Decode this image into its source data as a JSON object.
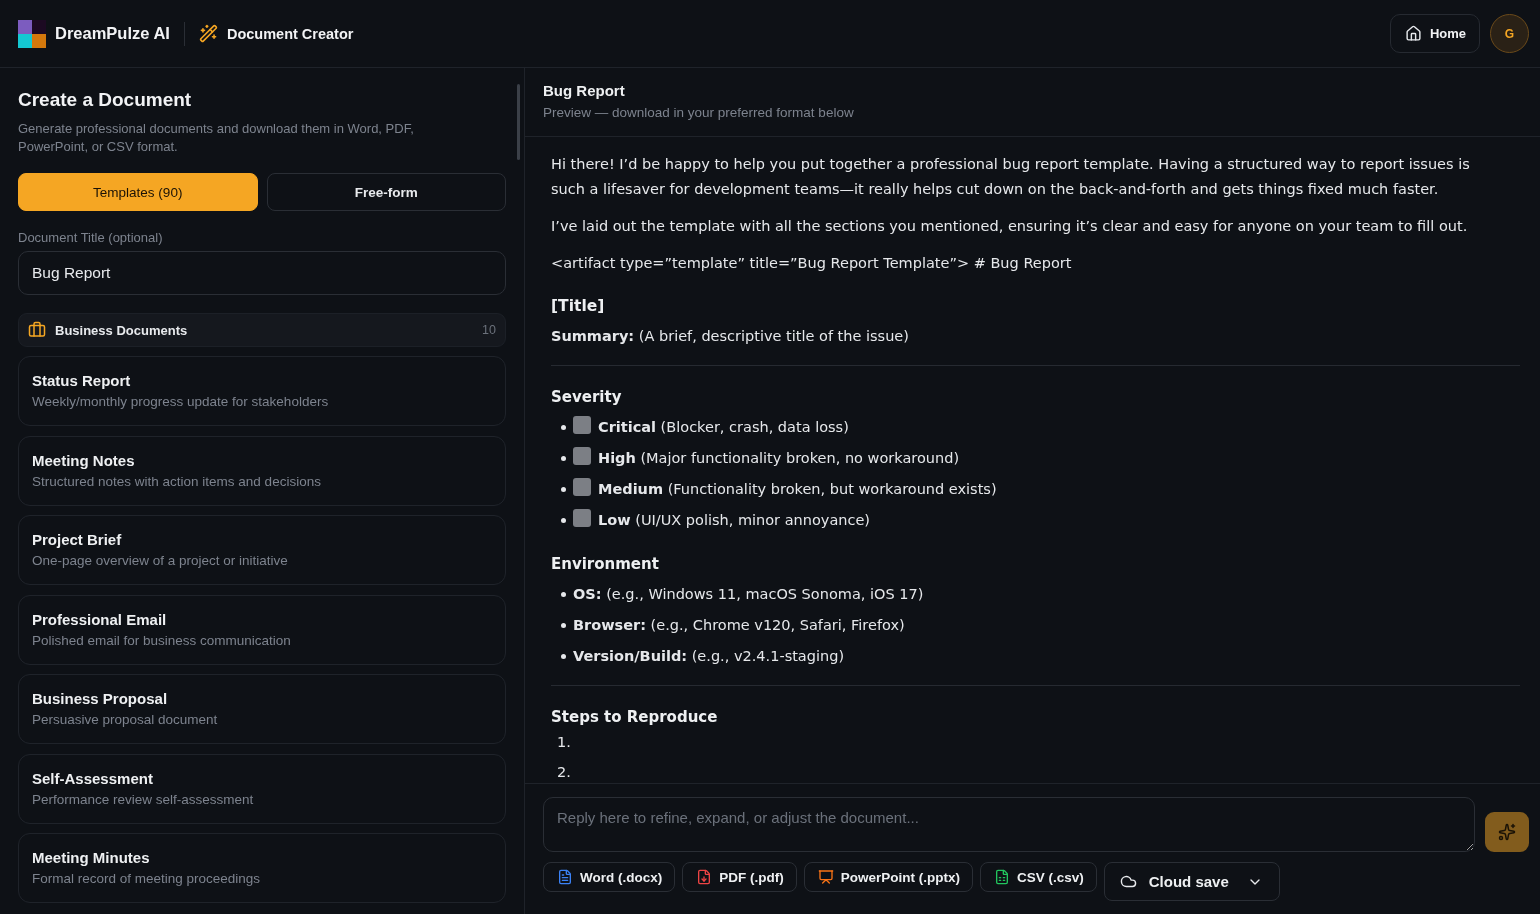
{
  "header": {
    "brand": "DreamPulze AI",
    "section": "Document Creator",
    "home": "Home",
    "avatar": "G"
  },
  "sidebar": {
    "title": "Create a Document",
    "description": "Generate professional documents and download them in Word, PDF, PowerPoint, or CSV format.",
    "tabs": [
      {
        "label": "Templates (90)",
        "selected": true
      },
      {
        "label": "Free-form",
        "selected": false
      }
    ],
    "title_field": {
      "label": "Document Title (optional)",
      "value": "Bug Report"
    },
    "category": {
      "name": "Business Documents",
      "count": "10"
    },
    "templates": [
      {
        "name": "Status Report",
        "description": "Weekly/monthly progress update for stakeholders"
      },
      {
        "name": "Meeting Notes",
        "description": "Structured notes with action items and decisions"
      },
      {
        "name": "Project Brief",
        "description": "One-page overview of a project or initiative"
      },
      {
        "name": "Professional Email",
        "description": "Polished email for business communication"
      },
      {
        "name": "Business Proposal",
        "description": "Persuasive proposal document"
      },
      {
        "name": "Self-Assessment",
        "description": "Performance review self-assessment"
      },
      {
        "name": "Meeting Minutes",
        "description": "Formal record of meeting proceedings"
      }
    ]
  },
  "preview": {
    "title": "Bug Report",
    "subtitle": "Preview — download in your preferred format below",
    "document": [
      {
        "kind": "paragraph",
        "text": "Hi there! I’d be happy to help you put together a professional bug report template. Having a structured way to report issues is such a lifesaver for development teams—it really helps cut down on the back-and-forth and gets things fixed much faster."
      },
      {
        "kind": "paragraph",
        "text": "I’ve laid out the template with all the sections you mentioned, ensuring it’s clear and easy for anyone on your team to fill out."
      },
      {
        "kind": "paragraph",
        "text": "<artifact type=”template” title=”Bug Report Template”> # Bug Report"
      },
      {
        "kind": "title",
        "text": "[Title]"
      },
      {
        "kind": "paragraph",
        "text": "**Summary:** (A brief, descriptive title of the issue)"
      },
      {
        "kind": "rule"
      },
      {
        "kind": "heading",
        "text": "Severity"
      },
      {
        "kind": "checklist",
        "items": [
          {
            "text": "**Critical** (Blocker, crash, data loss)",
            "checked": false
          },
          {
            "text": "**High** (Major functionality broken, no workaround)",
            "checked": false
          },
          {
            "text": "**Medium** (Functionality broken, but workaround exists)",
            "checked": false
          },
          {
            "text": "**Low** (UI/UX polish, minor annoyance)",
            "checked": false
          }
        ]
      },
      {
        "kind": "heading",
        "text": "Environment"
      },
      {
        "kind": "bullets",
        "items": [
          "**OS:** (e.g., Windows 11, macOS Sonoma, iOS 17)",
          "**Browser:** (e.g., Chrome v120, Safari, Firefox)",
          "**Version/Build:** (e.g., v2.4.1-staging)"
        ]
      },
      {
        "kind": "rule"
      },
      {
        "kind": "heading",
        "text": "Steps to Reproduce"
      },
      {
        "kind": "numbered",
        "items": [
          "1.",
          "2."
        ]
      }
    ]
  },
  "reply": {
    "placeholder": "Reply here to refine, expand, or adjust the document...",
    "send_disabled": true
  },
  "exports": [
    {
      "kind": "word",
      "label": "Word (.docx)"
    },
    {
      "kind": "pdf",
      "label": "PDF (.pdf)"
    },
    {
      "kind": "powerpoint",
      "label": "PowerPoint (.pptx)"
    },
    {
      "kind": "csv",
      "label": "CSV (.csv)"
    }
  ],
  "cloud_save": {
    "label": "Cloud save"
  }
}
